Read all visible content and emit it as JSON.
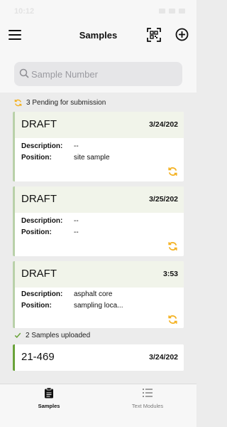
{
  "status_bar": {
    "time": "10:12"
  },
  "nav": {
    "title": "Samples"
  },
  "search": {
    "placeholder": "Sample Number"
  },
  "pending": {
    "label": "3 Pending for submission"
  },
  "uploaded": {
    "label": "2 Samples uploaded"
  },
  "cards": [
    {
      "status": "DRAFT",
      "date": "3/24/202",
      "description_label": "Description:",
      "description": "--",
      "position_label": "Position:",
      "position": "site sample"
    },
    {
      "status": "DRAFT",
      "date": "3/25/202",
      "description_label": "Description:",
      "description": "--",
      "position_label": "Position:",
      "position": "--"
    },
    {
      "status": "DRAFT",
      "date": "3:53",
      "description_label": "Description:",
      "description": "asphalt core",
      "position_label": "Position:",
      "position": "sampling loca..."
    }
  ],
  "uploaded_cards": [
    {
      "number": "21-469",
      "date": "3/24/202"
    }
  ],
  "tabs": [
    {
      "label": "Samples",
      "icon": "clipboard-icon",
      "active": true
    },
    {
      "label": "Text Modules",
      "icon": "list-icon",
      "active": false
    }
  ],
  "colors": {
    "accent_sync": "#f4b223",
    "draft_border": "#b9d1a9",
    "uploaded_border": "#6aa33a",
    "check": "#6aa33a"
  }
}
